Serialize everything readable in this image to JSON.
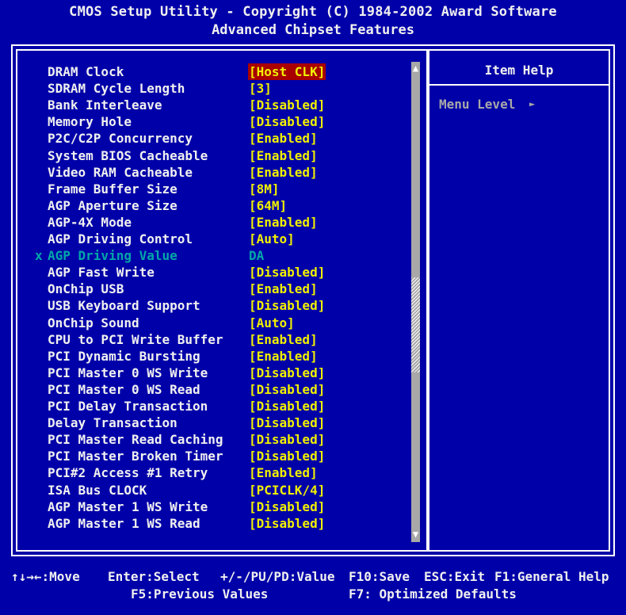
{
  "header": {
    "line1": "CMOS Setup Utility - Copyright (C) 1984-2002 Award Software",
    "line2": "Advanced Chipset Features"
  },
  "settings": [
    {
      "label": "DRAM Clock",
      "value": "[Host CLK]",
      "selected": true
    },
    {
      "label": "SDRAM Cycle Length",
      "value": "[3]"
    },
    {
      "label": "Bank Interleave",
      "value": "[Disabled]"
    },
    {
      "label": "Memory Hole",
      "value": "[Disabled]"
    },
    {
      "label": "P2C/C2P Concurrency",
      "value": "[Enabled]"
    },
    {
      "label": "System BIOS Cacheable",
      "value": "[Enabled]"
    },
    {
      "label": "Video RAM Cacheable",
      "value": "[Enabled]"
    },
    {
      "label": "Frame Buffer Size",
      "value": "[8M]"
    },
    {
      "label": "AGP Aperture Size",
      "value": "[64M]"
    },
    {
      "label": "AGP-4X Mode",
      "value": "[Enabled]"
    },
    {
      "label": "AGP Driving Control",
      "value": "[Auto]"
    },
    {
      "label": "AGP Driving Value",
      "value": "DA",
      "disabled": true,
      "mark": "x"
    },
    {
      "label": "AGP Fast Write",
      "value": "[Disabled]"
    },
    {
      "label": "OnChip USB",
      "value": "[Enabled]"
    },
    {
      "label": "USB Keyboard Support",
      "value": "[Disabled]"
    },
    {
      "label": "OnChip Sound",
      "value": "[Auto]"
    },
    {
      "label": "CPU to PCI Write Buffer",
      "value": "[Enabled]"
    },
    {
      "label": "PCI Dynamic Bursting",
      "value": "[Enabled]"
    },
    {
      "label": "PCI Master 0 WS Write",
      "value": "[Disabled]"
    },
    {
      "label": "PCI Master 0 WS Read",
      "value": "[Disabled]"
    },
    {
      "label": "PCI Delay Transaction",
      "value": "[Disabled]"
    },
    {
      "label": "Delay Transaction",
      "value": "[Disabled]"
    },
    {
      "label": "PCI Master Read Caching",
      "value": "[Disabled]"
    },
    {
      "label": "PCI Master Broken Timer",
      "value": "[Disabled]"
    },
    {
      "label": "PCI#2 Access #1 Retry",
      "value": "[Enabled]"
    },
    {
      "label": "ISA Bus CLOCK",
      "value": "[PCICLK/4]"
    },
    {
      "label": "AGP Master 1 WS Write",
      "value": "[Disabled]"
    },
    {
      "label": "AGP Master 1 WS Read",
      "value": "[Disabled]"
    }
  ],
  "help": {
    "title": "Item Help",
    "menu_level": "Menu Level",
    "menu_arrow": "►"
  },
  "scroll": {
    "up": "▲",
    "down": "▼"
  },
  "footer": {
    "move": "↑↓→←:Move",
    "select": "Enter:Select",
    "value": "+/-/PU/PD:Value",
    "save": "F10:Save",
    "exit": "ESC:Exit",
    "general_help": "F1:General Help",
    "previous": "F5:Previous Values",
    "defaults": "F7: Optimized Defaults"
  },
  "colors": {
    "background": "#0000a8",
    "value": "#f0f000",
    "label": "#f0f0f0",
    "disabled": "#00a8a8",
    "selection": "#a80000"
  }
}
